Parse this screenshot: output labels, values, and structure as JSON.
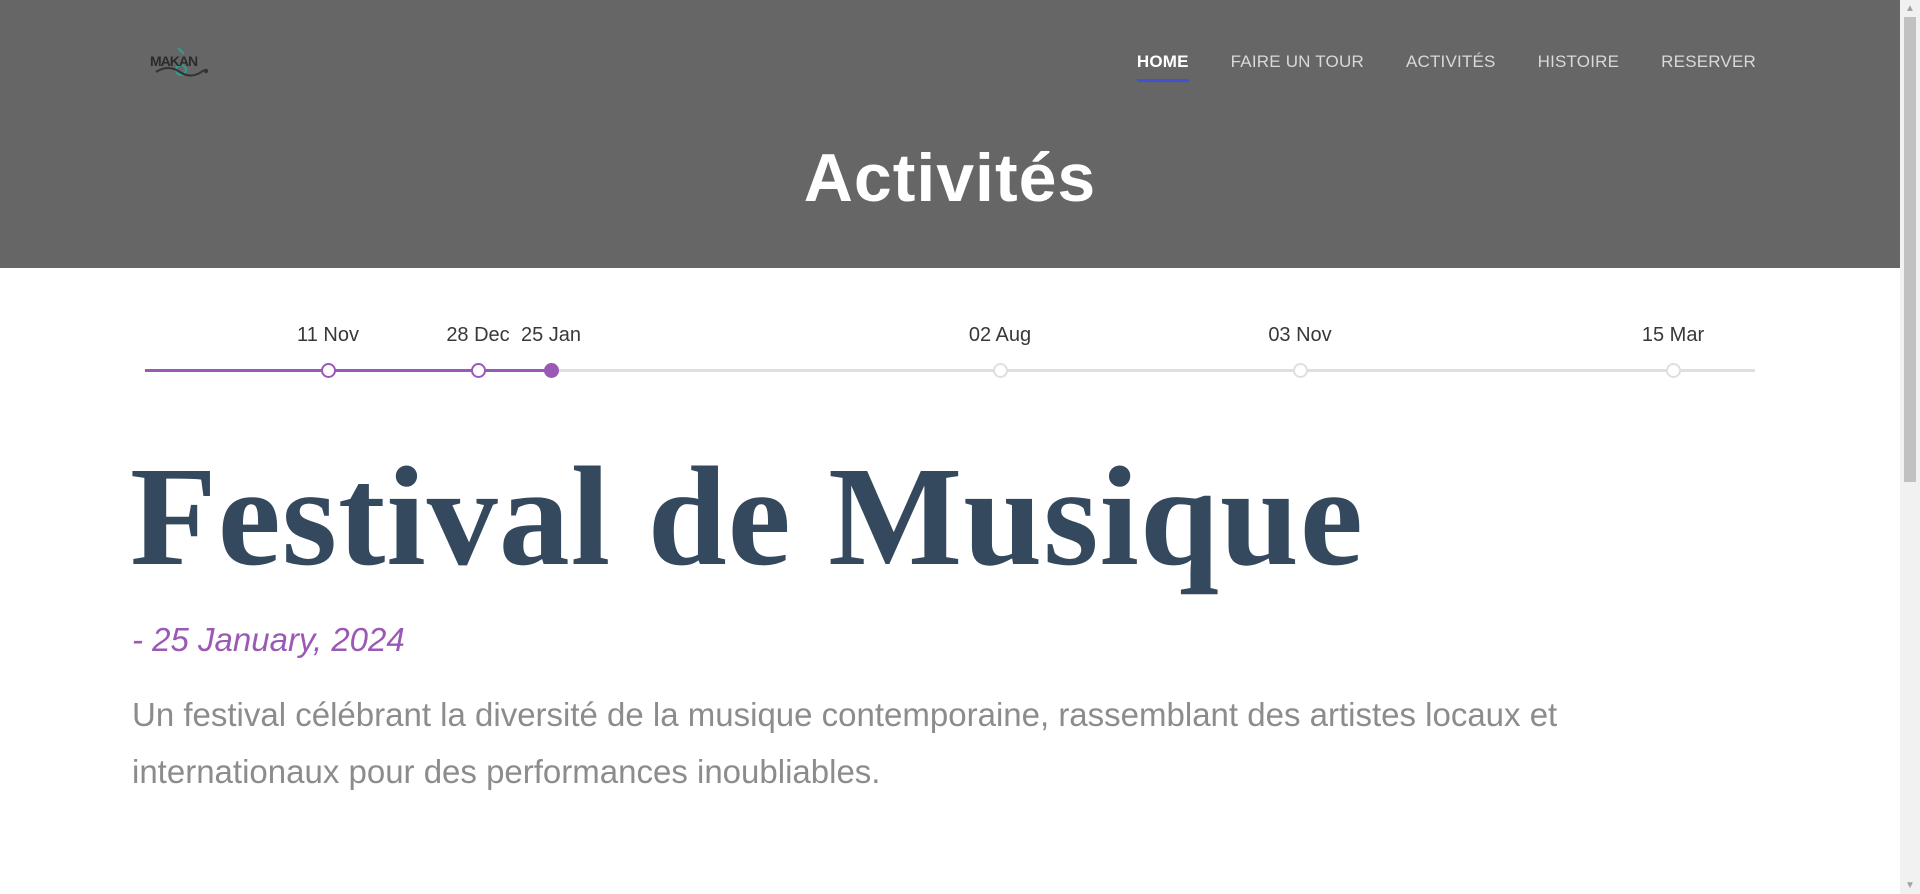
{
  "header": {
    "logo_text": "MAKAN",
    "title": "Activités",
    "nav": [
      {
        "label": "HOME",
        "active": true
      },
      {
        "label": "FAIRE UN TOUR",
        "active": false
      },
      {
        "label": "ACTIVITÉS",
        "active": false
      },
      {
        "label": "HISTOIRE",
        "active": false
      },
      {
        "label": "RESERVER",
        "active": false
      }
    ]
  },
  "timeline": {
    "progress_fraction": 0.253,
    "events": [
      {
        "label": "11 Nov",
        "state": "past"
      },
      {
        "label": "28 Dec",
        "state": "past"
      },
      {
        "label": "25 Jan",
        "state": "selected"
      },
      {
        "label": "02 Aug",
        "state": "future"
      },
      {
        "label": "03 Nov",
        "state": "future"
      },
      {
        "label": "15 Mar",
        "state": "future"
      }
    ]
  },
  "event": {
    "title": "Festival de Musique",
    "date": "- 25 January, 2024",
    "description": "Un festival célébrant la diversité de la musique contemporaine, rassemblant des artistes locaux et internationaux pour des performances inoubliables."
  },
  "colors": {
    "header_bg": "#666666",
    "accent_purple": "#9b59b6",
    "title_color": "#34495e",
    "nav_active_underline": "#3f51d4"
  }
}
